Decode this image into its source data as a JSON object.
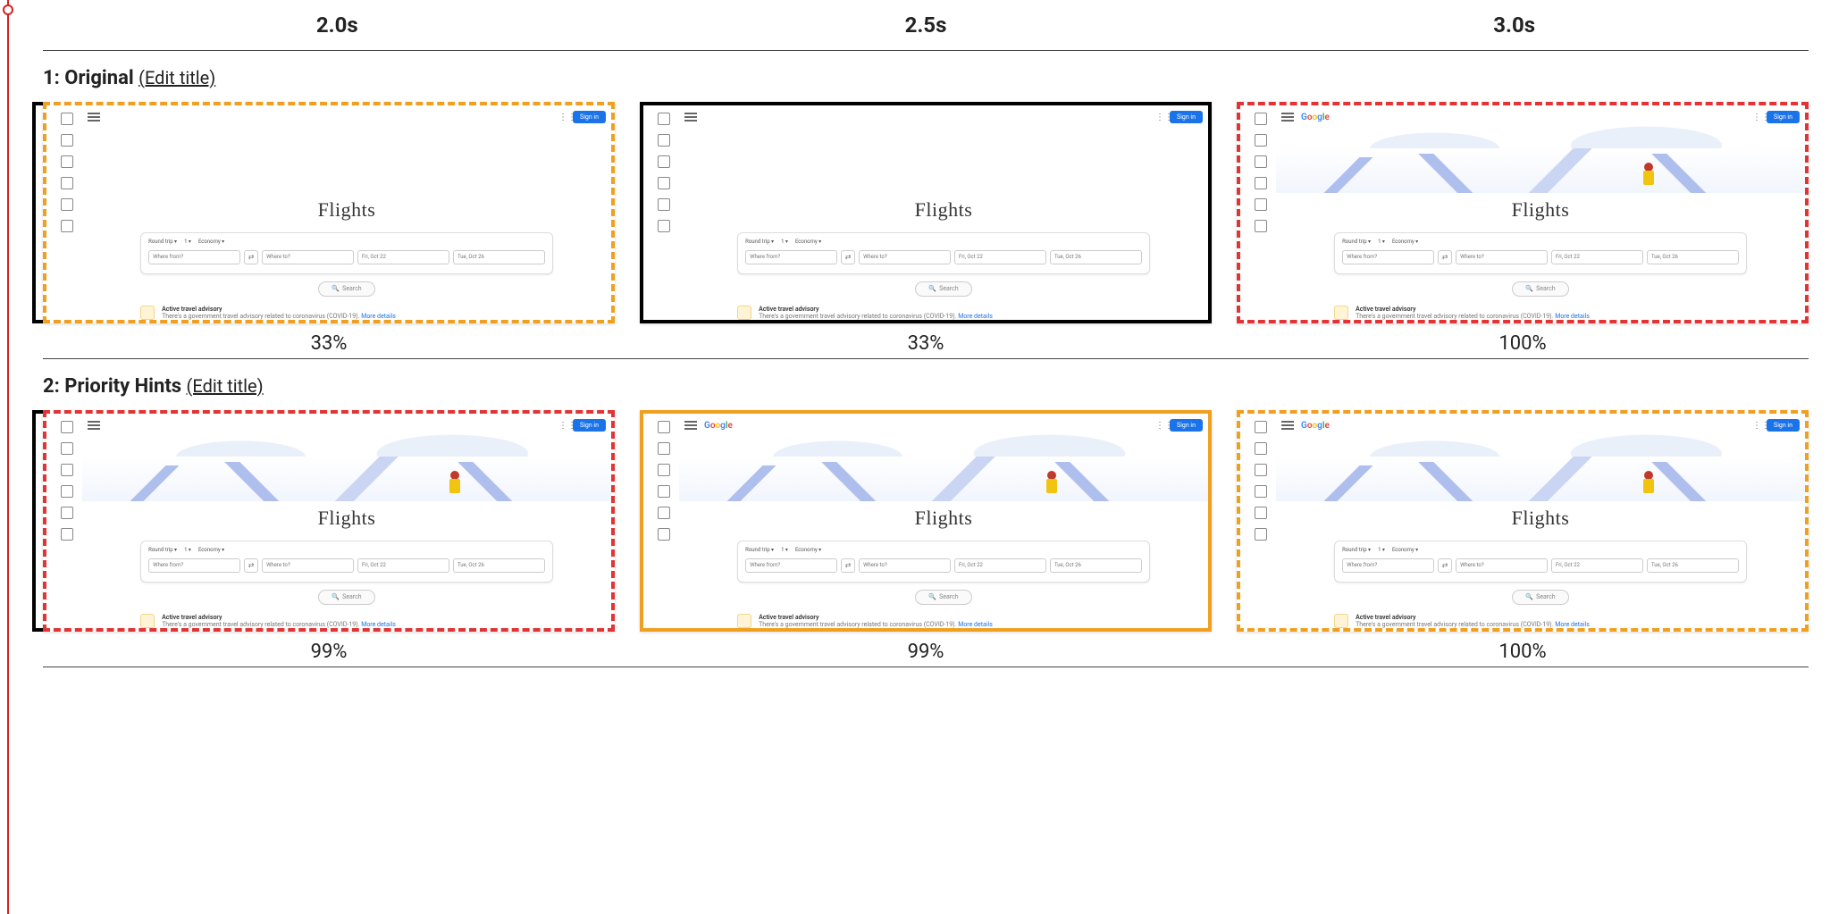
{
  "times": [
    "2.0s",
    "2.5s",
    "3.0s"
  ],
  "edit_label": "(Edit title)",
  "rows": [
    {
      "index": "1",
      "name": "Original",
      "frames": [
        {
          "percent": "33%",
          "border": "dashed-orange",
          "bracket": true,
          "hero": "blank",
          "logo": false
        },
        {
          "percent": "33%",
          "border": "solid-black",
          "bracket": false,
          "hero": "blank",
          "logo": false
        },
        {
          "percent": "100%",
          "border": "dashed-red",
          "bracket": false,
          "hero": "illust",
          "logo": true
        }
      ]
    },
    {
      "index": "2",
      "name": "Priority Hints",
      "frames": [
        {
          "percent": "99%",
          "border": "dashed-red",
          "bracket": true,
          "hero": "illust",
          "logo": false
        },
        {
          "percent": "99%",
          "border": "solid-orange",
          "bracket": false,
          "hero": "illust",
          "logo": true
        },
        {
          "percent": "100%",
          "border": "dashed-orange",
          "bracket": false,
          "hero": "illust",
          "logo": true
        }
      ]
    }
  ],
  "mock": {
    "brand": "Google",
    "signin": "Sign in",
    "title": "Flights",
    "chips": {
      "trip": "Round trip ▾",
      "pax": "1 ▾",
      "cabin": "Economy ▾"
    },
    "fields": {
      "from": "Where from?",
      "to": "Where to?",
      "date1": "Fri, Oct 22",
      "date2": "Tue, Oct 26"
    },
    "search_btn": "Search",
    "advisory_title": "Active travel advisory",
    "advisory_sub": "There's a government travel advisory related to coronavirus (COVID-19).",
    "advisory_more": "More details"
  }
}
